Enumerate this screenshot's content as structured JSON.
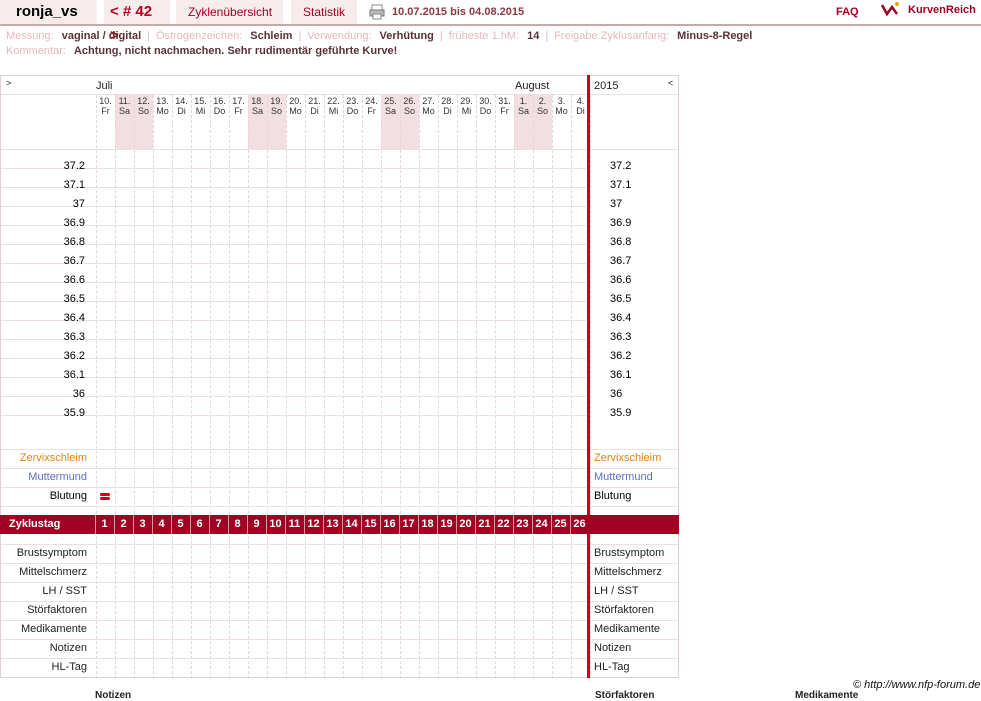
{
  "header": {
    "username": "ronja_vs",
    "cycle_nav": "< # 42 >",
    "overview_tab": "Zyklenübersicht",
    "stats_tab": "Statistik",
    "date_range": "10.07.2015 bis 04.08.2015",
    "faq": "FAQ",
    "logo": "KurvenReich"
  },
  "info": {
    "measurement_label": "Messung:",
    "measurement_value": "vaginal / digital",
    "estrogen_label": "Östrogenzeichen:",
    "estrogen_value": "Schleim",
    "usage_label": "Verwendung:",
    "usage_value": "Verhütung",
    "earliest_label": "früheste 1.hM:",
    "earliest_value": "14",
    "release_label": "Freigabe Zyklusanfang:",
    "release_value": "Minus-8-Regel",
    "comment_label": "Kommentar:",
    "comment_value": "Achtung, nicht nachmachen. Sehr rudimentär geführte Kurve!"
  },
  "chart_nav": {
    "left_arrow": ">",
    "right_arrow": "<",
    "month1": "Juli",
    "month2": "August",
    "year": "2015"
  },
  "days": [
    {
      "d": "10.",
      "w": "Fr",
      "we": false
    },
    {
      "d": "11.",
      "w": "Sa",
      "we": true
    },
    {
      "d": "12.",
      "w": "So",
      "we": true
    },
    {
      "d": "13.",
      "w": "Mo",
      "we": false
    },
    {
      "d": "14.",
      "w": "Di",
      "we": false
    },
    {
      "d": "15.",
      "w": "Mi",
      "we": false
    },
    {
      "d": "16.",
      "w": "Do",
      "we": false
    },
    {
      "d": "17.",
      "w": "Fr",
      "we": false
    },
    {
      "d": "18.",
      "w": "Sa",
      "we": true
    },
    {
      "d": "19.",
      "w": "So",
      "we": true
    },
    {
      "d": "20.",
      "w": "Mo",
      "we": false
    },
    {
      "d": "21.",
      "w": "Di",
      "we": false
    },
    {
      "d": "22.",
      "w": "Mi",
      "we": false
    },
    {
      "d": "23.",
      "w": "Do",
      "we": false
    },
    {
      "d": "24.",
      "w": "Fr",
      "we": false
    },
    {
      "d": "25.",
      "w": "Sa",
      "we": true
    },
    {
      "d": "26.",
      "w": "So",
      "we": true
    },
    {
      "d": "27.",
      "w": "Mo",
      "we": false
    },
    {
      "d": "28.",
      "w": "Di",
      "we": false
    },
    {
      "d": "29.",
      "w": "Mi",
      "we": false
    },
    {
      "d": "30.",
      "w": "Do",
      "we": false
    },
    {
      "d": "31.",
      "w": "Fr",
      "we": false
    },
    {
      "d": "1.",
      "w": "Sa",
      "we": true
    },
    {
      "d": "2.",
      "w": "So",
      "we": true
    },
    {
      "d": "3.",
      "w": "Mo",
      "we": false
    },
    {
      "d": "4.",
      "w": "Di",
      "we": false
    }
  ],
  "temps": [
    "37.2",
    "37.1",
    "37",
    "36.9",
    "36.8",
    "36.7",
    "36.6",
    "36.5",
    "36.4",
    "36.3",
    "36.2",
    "36.1",
    "36",
    "35.9"
  ],
  "rows_top": [
    {
      "label": "Zervixschleim",
      "color": "#e0801a"
    },
    {
      "label": "Muttermund",
      "color": "#5b6fc4"
    },
    {
      "label": "Blutung",
      "color": "#000000"
    }
  ],
  "cycle_bar": {
    "label": "Zyklustag",
    "days": [
      "1",
      "2",
      "3",
      "4",
      "5",
      "6",
      "7",
      "8",
      "9",
      "10",
      "11",
      "12",
      "13",
      "14",
      "15",
      "16",
      "17",
      "18",
      "19",
      "20",
      "21",
      "22",
      "23",
      "24",
      "25",
      "26"
    ]
  },
  "rows_bottom": [
    "Brustsymptom",
    "Mittelschmerz",
    "LH / SST",
    "Störfaktoren",
    "Medikamente",
    "Notizen",
    "HL-Tag"
  ],
  "bleeding_day": 1,
  "footer": {
    "copyright": "© http://www.nfp-forum.de",
    "col_notes": "Notizen",
    "col_factors": "Störfaktoren",
    "col_meds": "Medikamente"
  },
  "colors": {
    "accent": "#a00022",
    "redline": "#d0001c",
    "weekend": "#f1dfe2",
    "bleeding": "#d0001c"
  }
}
